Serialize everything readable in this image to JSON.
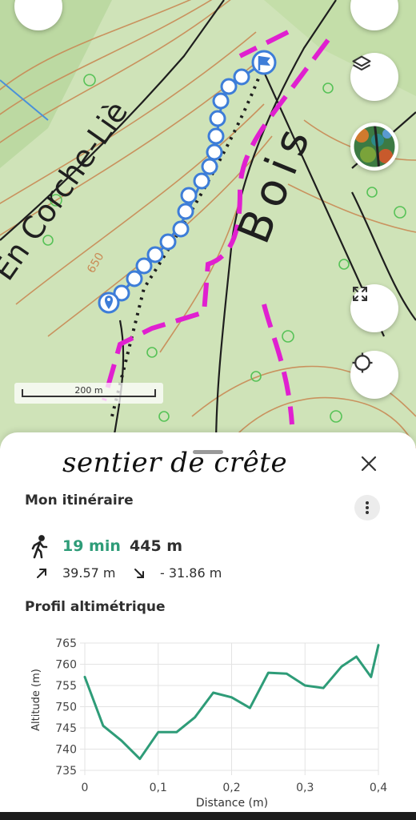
{
  "map": {
    "labels": {
      "place_name": "En Corche-Liè",
      "wood_name": "Bois",
      "contour_value": "650"
    },
    "scale": {
      "label": "200 m"
    },
    "controls": [
      "back-icon",
      "filters-icon",
      "layers-icon",
      "satellite-thumbnail",
      "fullscreen-icon",
      "locate-icon"
    ],
    "colors": {
      "route": "#3d7dd8",
      "boundary": "#e020d0",
      "contour": "#c98a55",
      "land": "#cfe3b8"
    }
  },
  "sheet": {
    "title": "sentier de crête",
    "itinerary_label": "Mon itinéraire",
    "duration": "19 min",
    "distance": "445 m",
    "ascent": "39.57 m",
    "descent": "- 31.86 m",
    "profile_label": "Profil altimétrique"
  },
  "colors": {
    "accent": "#2e9c78",
    "text": "#2f2f2f"
  },
  "chart_data": {
    "type": "line",
    "xlabel": "Distance (m)",
    "ylabel": "Altitude (m)",
    "xlim": [
      0,
      0.4
    ],
    "ylim": [
      735,
      765
    ],
    "xticks": [
      "0",
      "0,1",
      "0,2",
      "0,3",
      "0,4"
    ],
    "yticks": [
      "765",
      "760",
      "755",
      "750",
      "745",
      "740",
      "735"
    ],
    "grid": true,
    "series": [
      {
        "x": [
          0,
          0.025,
          0.05,
          0.075,
          0.1,
          0.125,
          0.15,
          0.175,
          0.2,
          0.225,
          0.25,
          0.275,
          0.3,
          0.325,
          0.35,
          0.37,
          0.39,
          0.4
        ],
        "values": [
          757,
          745.5,
          742,
          737.7,
          744,
          744,
          747.5,
          753.3,
          752.2,
          749.7,
          758,
          757.8,
          755,
          754.4,
          759.5,
          761.8,
          757,
          764.5
        ]
      }
    ]
  }
}
